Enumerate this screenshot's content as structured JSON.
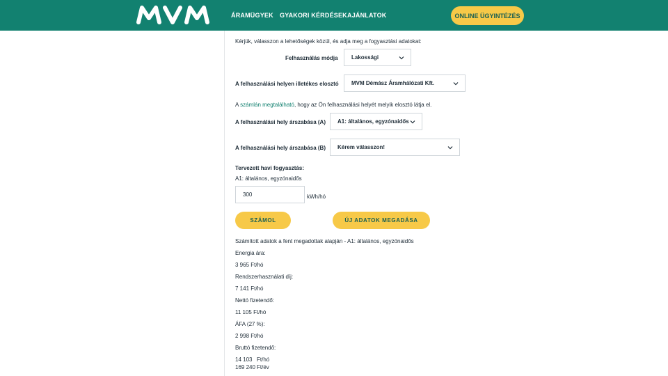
{
  "header": {
    "brand": "MVM",
    "nav": [
      "ÁRAMÜGYEK",
      "GYAKORI KÉRDÉSEK",
      "AJÁNLATOK"
    ],
    "cta": "ONLINE ÜGYINTÉZÉS"
  },
  "form": {
    "intro": "Kérjük, válasszon a lehetőségek közül, és adja meg a fogyasztási adatokat:",
    "mode_label": "Felhasználás módja",
    "mode_value": "Lakossági",
    "distributor_label": "A felhasználási helyen illetékes elosztó",
    "distributor_value": "MVM Démász Áramhálózati Kft.",
    "hint_prefix": "A ",
    "hint_link": "számlán megtalálható",
    "hint_suffix": ", hogy az Ön felhasználási helyét melyik elosztó látja el.",
    "tariff_a_label": "A felhasználási hely árszabása (A)",
    "tariff_a_value": "A1: általános, egyzónaidős",
    "tariff_b_label": "A felhasználási hely árszabása (B)",
    "tariff_b_value": "Kérem válasszon!",
    "planned_label": "Tervezett havi fogyasztás:",
    "planned_sub": "A1: általános, egyzónaidős",
    "consumption_value": "300",
    "unit": "kWh/hó",
    "calc_button": "SZÁMOL",
    "reset_button": "ÚJ ADATOK MEGADÁSA"
  },
  "results": {
    "heading": "Számított adatok a fent megadottak alapján - A1: általános, egyzónaidős",
    "energy_label": "Energia ára:",
    "energy_value": "3 965  Ft/hó",
    "system_label": "Rendszerhasználati díj:",
    "system_value": "7 141  Ft/hó",
    "net_label": "Nettó fizetendő:",
    "net_value": "11 105  Ft/hó",
    "vat_label": "ÁFA (27 %):",
    "vat_value": "2 998  Ft/hó",
    "gross_label": "Bruttó fizetendő:",
    "gross_month": "14 103",
    "gross_month_unit": "Ft/hó",
    "gross_year": "169 240",
    "gross_year_unit": "Ft/év"
  },
  "colors": {
    "header_bg": "#128170",
    "accent_yellow": "#f7c948",
    "link_green": "#128170"
  }
}
